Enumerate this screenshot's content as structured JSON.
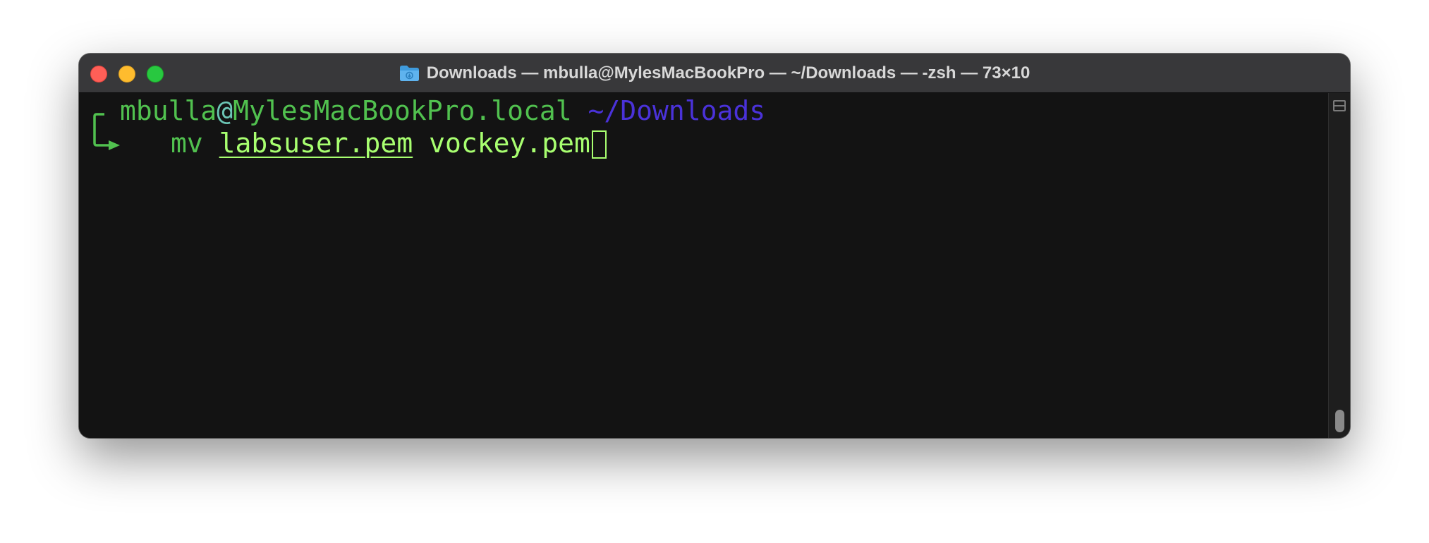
{
  "window": {
    "title": "Downloads — mbulla@MylesMacBookPro — ~/Downloads — -zsh — 73×10",
    "folder_icon": "folder-icon"
  },
  "terminal": {
    "prompt_user": "mbulla",
    "prompt_at": "@",
    "prompt_host": "MylesMacBookPro.local",
    "prompt_path": "~/Downloads",
    "command": "mv",
    "arg1": "labsuser.pem",
    "arg2": "vockey.pem"
  },
  "colors": {
    "titlebar": "#38383a",
    "background": "#131313",
    "prompt_green": "#51c14f",
    "path_purple": "#4a32d9",
    "arg_green": "#a8ff70"
  }
}
